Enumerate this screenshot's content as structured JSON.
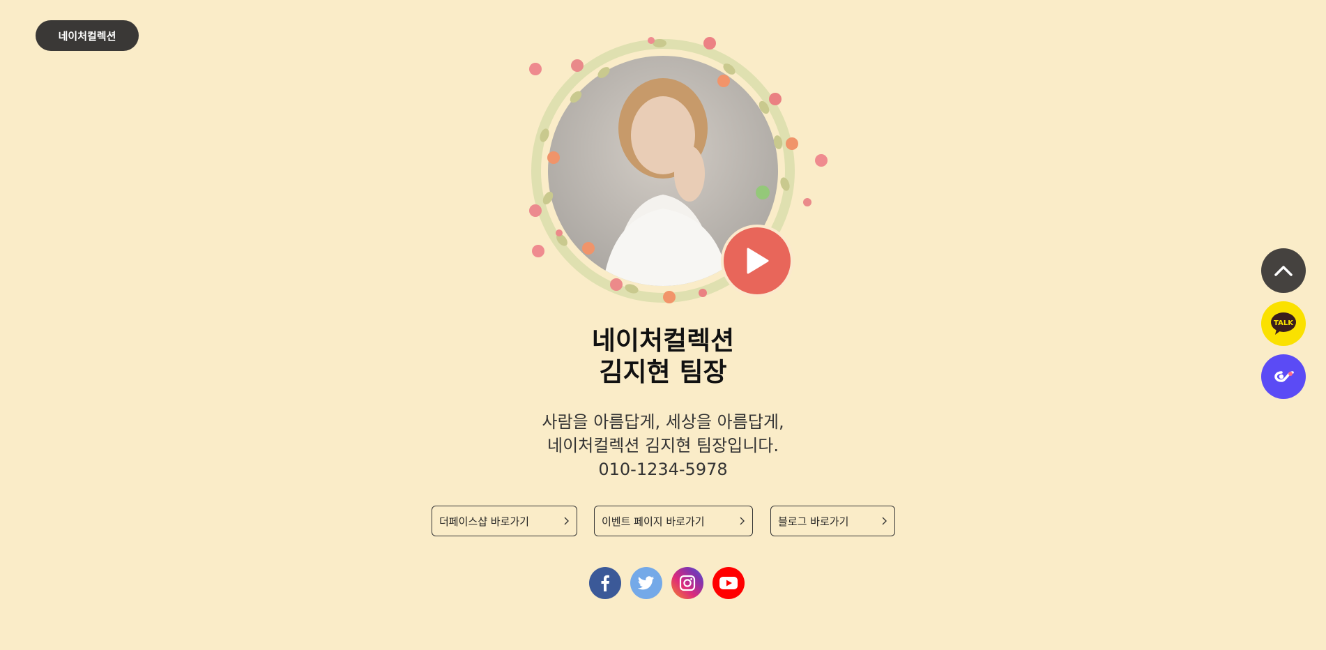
{
  "brand": {
    "label": "네이처컬렉션"
  },
  "hero": {
    "photo_icon": "profile-photo",
    "play_icon": "play-icon"
  },
  "profile": {
    "title_line1": "네이처컬렉션",
    "title_line2": "김지현 팀장",
    "desc_line1": "사람을 아름답게, 세상을 아름답게,",
    "desc_line2": "네이처컬렉션 김지현 팀장입니다.",
    "phone": "010-1234-5978"
  },
  "links": [
    {
      "label": "더페이스샵 바로가기"
    },
    {
      "label": "이벤트 페이지 바로가기"
    },
    {
      "label": "블로그 바로가기"
    }
  ],
  "social": [
    {
      "name": "facebook",
      "color": "#3b5998"
    },
    {
      "name": "twitter",
      "color": "#74a9e8"
    },
    {
      "name": "instagram",
      "color": "#9b3bb0"
    },
    {
      "name": "youtube",
      "color": "#ff0000"
    }
  ],
  "floating": {
    "top_icon": "chevron-up-icon",
    "talk_label": "TALK",
    "talk_color": "#fae100",
    "link_color": "#5b4bf5"
  }
}
